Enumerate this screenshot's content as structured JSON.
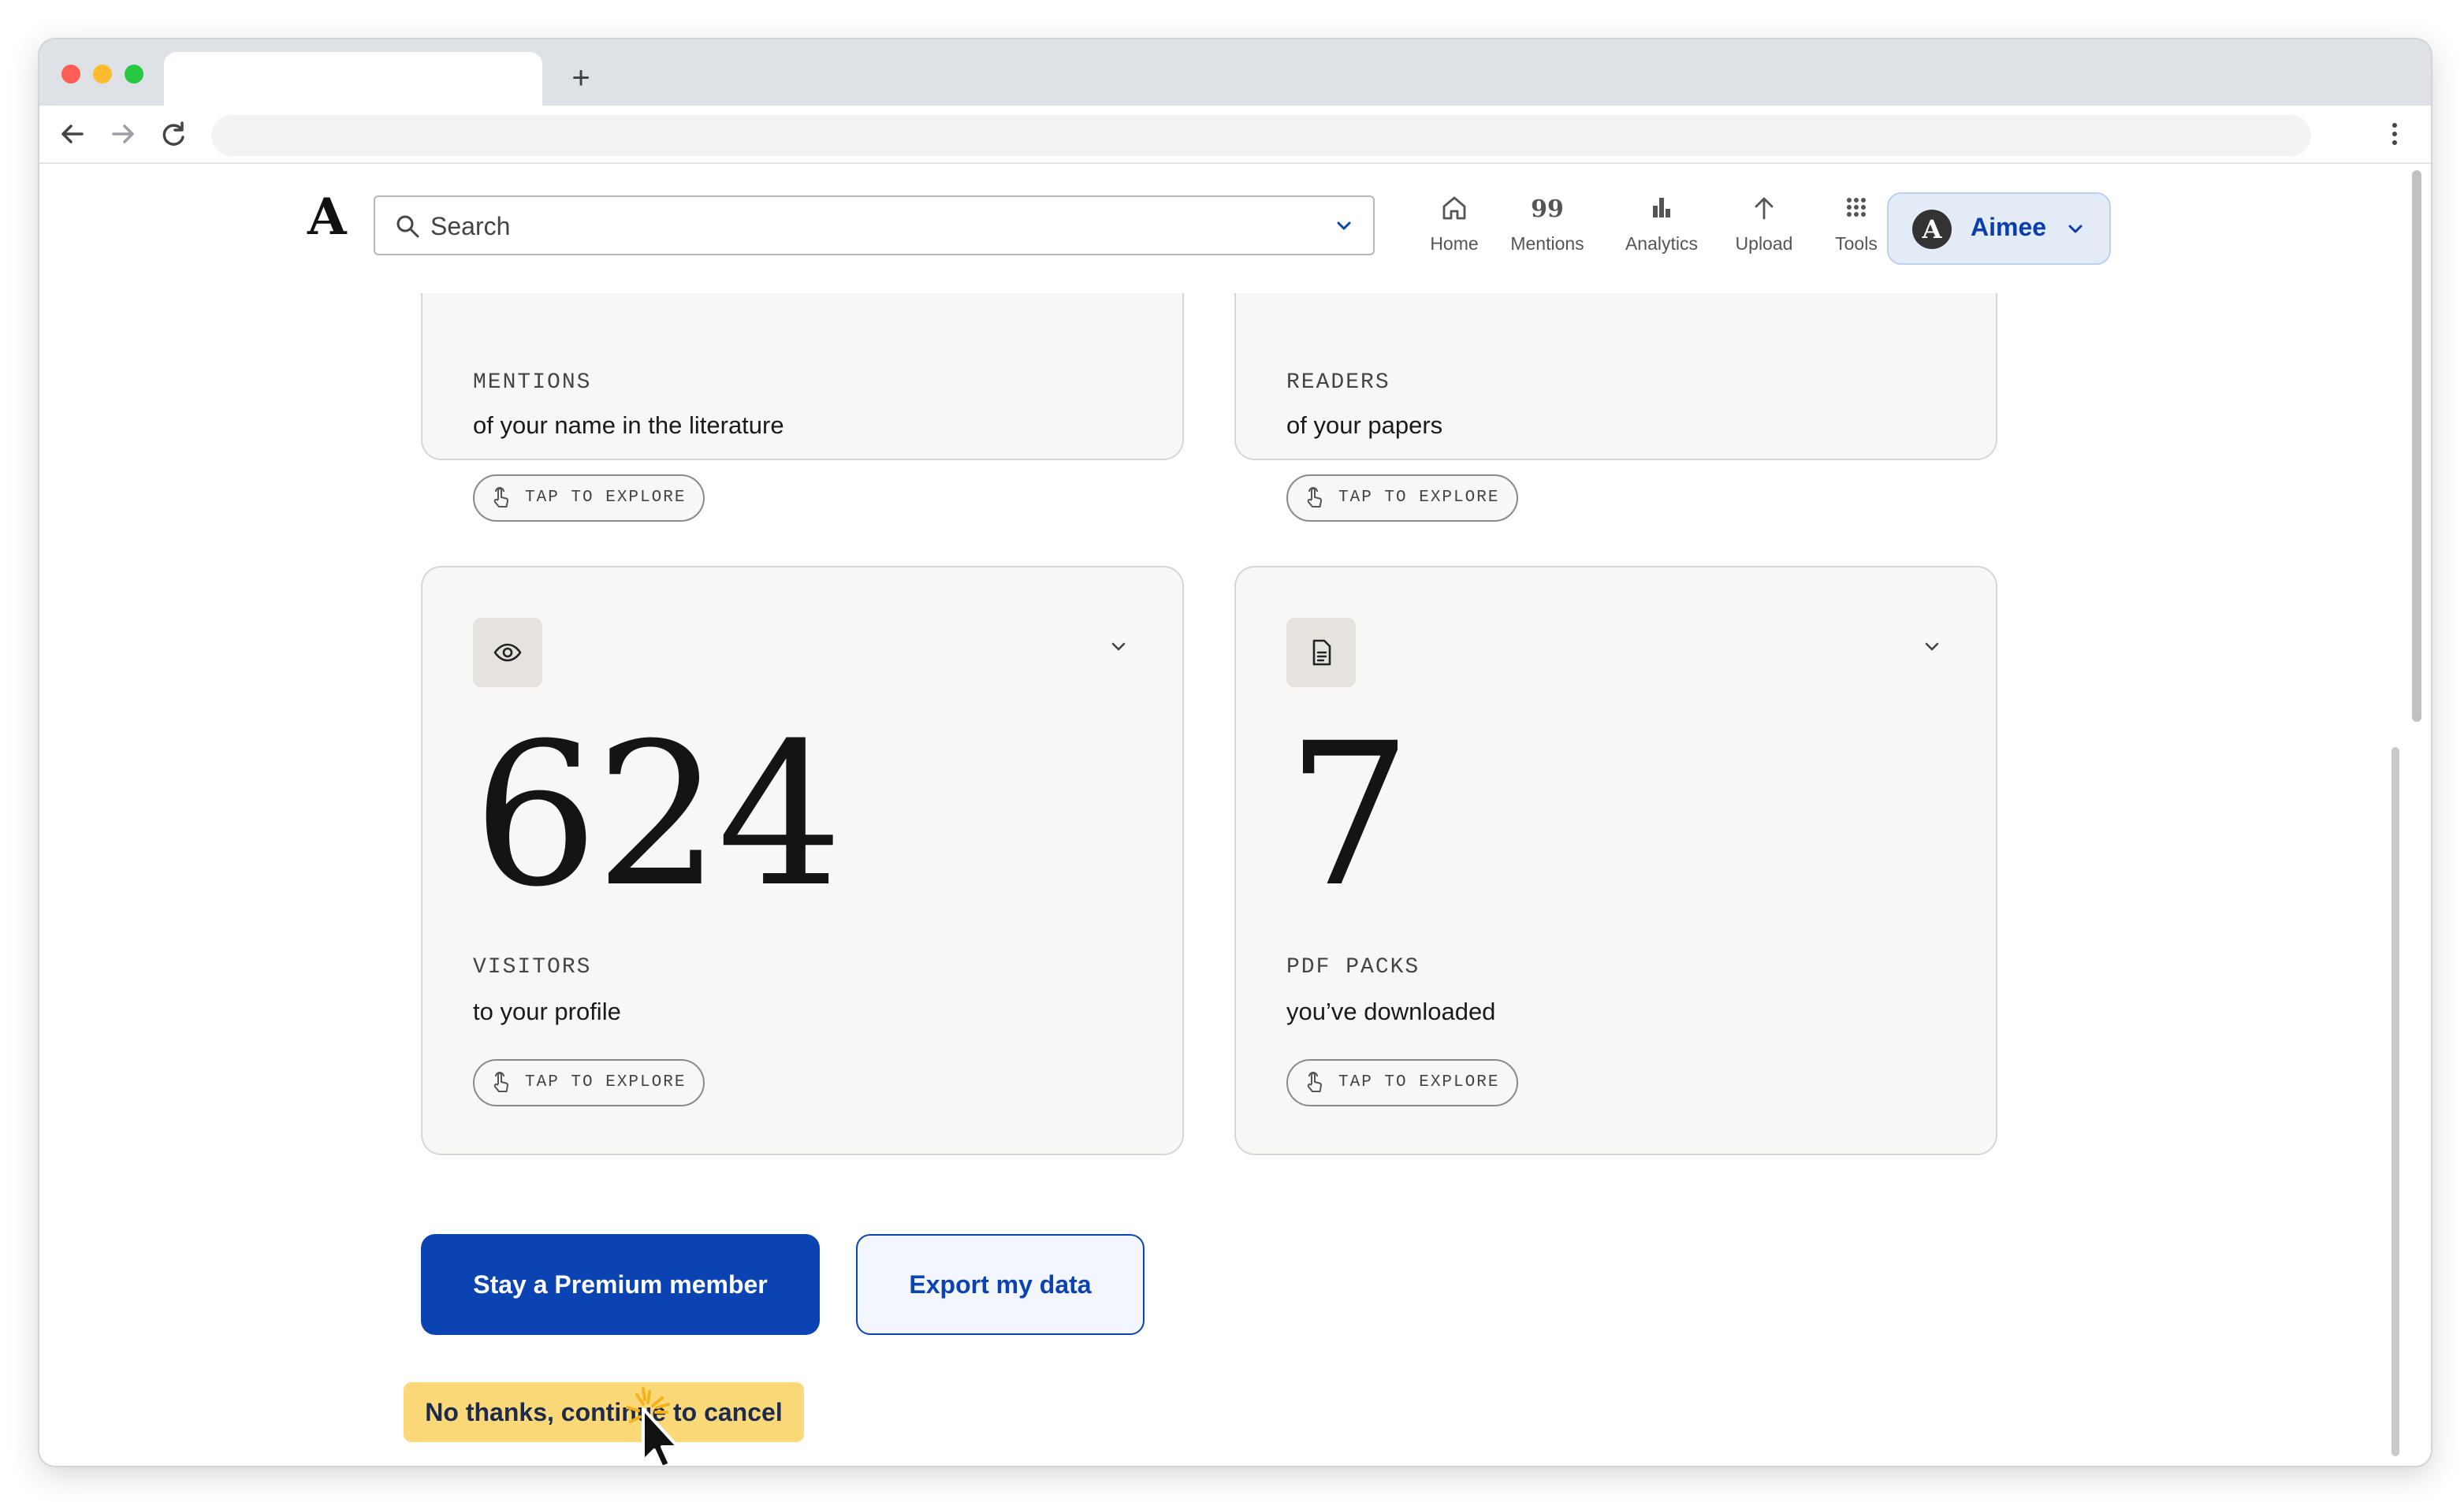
{
  "browser": {
    "new_tab_label": "+"
  },
  "header": {
    "logo_text": "A",
    "search_placeholder": "Search",
    "nav": [
      {
        "label": "Home",
        "icon": "home-icon"
      },
      {
        "label": "Mentions",
        "icon": "quote-icon",
        "glyph": "99"
      },
      {
        "label": "Analytics",
        "icon": "bar-chart-icon"
      },
      {
        "label": "Upload",
        "icon": "upload-arrow-icon"
      },
      {
        "label": "Tools",
        "icon": "grid-icon"
      }
    ],
    "account": {
      "initial": "A",
      "name": "Aimee"
    }
  },
  "cards": [
    {
      "label": "MENTIONS",
      "subtitle": "of your name in the literature",
      "explore": "TAP TO EXPLORE"
    },
    {
      "label": "READERS",
      "subtitle": "of your papers",
      "explore": "TAP TO EXPLORE"
    },
    {
      "icon": "eye-icon",
      "value": "624",
      "label": "VISITORS",
      "subtitle": "to your profile",
      "explore": "TAP TO EXPLORE"
    },
    {
      "icon": "document-icon",
      "value": "7",
      "label": "PDF PACKS",
      "subtitle": "you’ve downloaded",
      "explore": "TAP TO EXPLORE"
    }
  ],
  "actions": {
    "stay_label": "Stay a Premium member",
    "export_label": "Export my data",
    "cancel_label": "No thanks, continue to cancel"
  },
  "colors": {
    "primary": "#0b43b3",
    "highlight": "#fbd978",
    "card_bg": "#f8f7f5"
  }
}
